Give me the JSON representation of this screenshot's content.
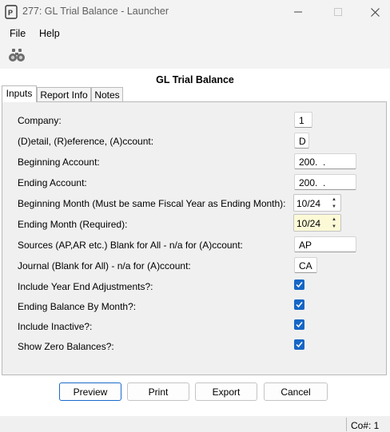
{
  "window": {
    "title": "277: GL Trial Balance - Launcher",
    "minimize_icon": "minimize-icon",
    "maximize_icon": "maximize-icon",
    "close_icon": "close-icon"
  },
  "menu": {
    "file": "File",
    "help": "Help"
  },
  "toolbar": {
    "search_icon": "binoculars-icon"
  },
  "form": {
    "title": "GL Trial Balance"
  },
  "tabs": [
    "Inputs",
    "Report Info",
    "Notes"
  ],
  "active_tab": "Inputs",
  "fields": {
    "company": {
      "label": "Company:",
      "value": "1"
    },
    "detail": {
      "label": "(D)etail, (R)eference, (A)ccount:",
      "value": "D"
    },
    "beginning_account": {
      "label": "Beginning Account:",
      "value": "200.  ."
    },
    "ending_account": {
      "label": "Ending Account:",
      "value": "200.  ."
    },
    "beginning_month": {
      "label": "Beginning Month (Must be same Fiscal Year as Ending Month):",
      "value": "10/24"
    },
    "ending_month": {
      "label": "Ending Month (Required):",
      "value": "10/24"
    },
    "sources": {
      "label": "Sources (AP,AR etc.) Blank for All - n/a for (A)ccount:",
      "value": "AP"
    },
    "journal": {
      "label": "Journal (Blank for All) - n/a for (A)ccount:",
      "value": "CA"
    }
  },
  "checkboxes": {
    "year_end": {
      "label": "Include Year End Adjustments?:",
      "checked": true
    },
    "by_month": {
      "label": "Ending Balance By Month?:",
      "checked": true
    },
    "inactive": {
      "label": "Include Inactive?:",
      "checked": true
    },
    "zero_balances": {
      "label": "Show Zero Balances?:",
      "checked": true
    }
  },
  "buttons": {
    "preview": "Preview",
    "print": "Print",
    "export": "Export",
    "cancel": "Cancel"
  },
  "status": {
    "company": "Co#: 1"
  },
  "colors": {
    "accent": "#1665c6",
    "required_field": "#fcfad6",
    "chrome": "#f3f3f3",
    "panel": "#f0f0f0"
  }
}
